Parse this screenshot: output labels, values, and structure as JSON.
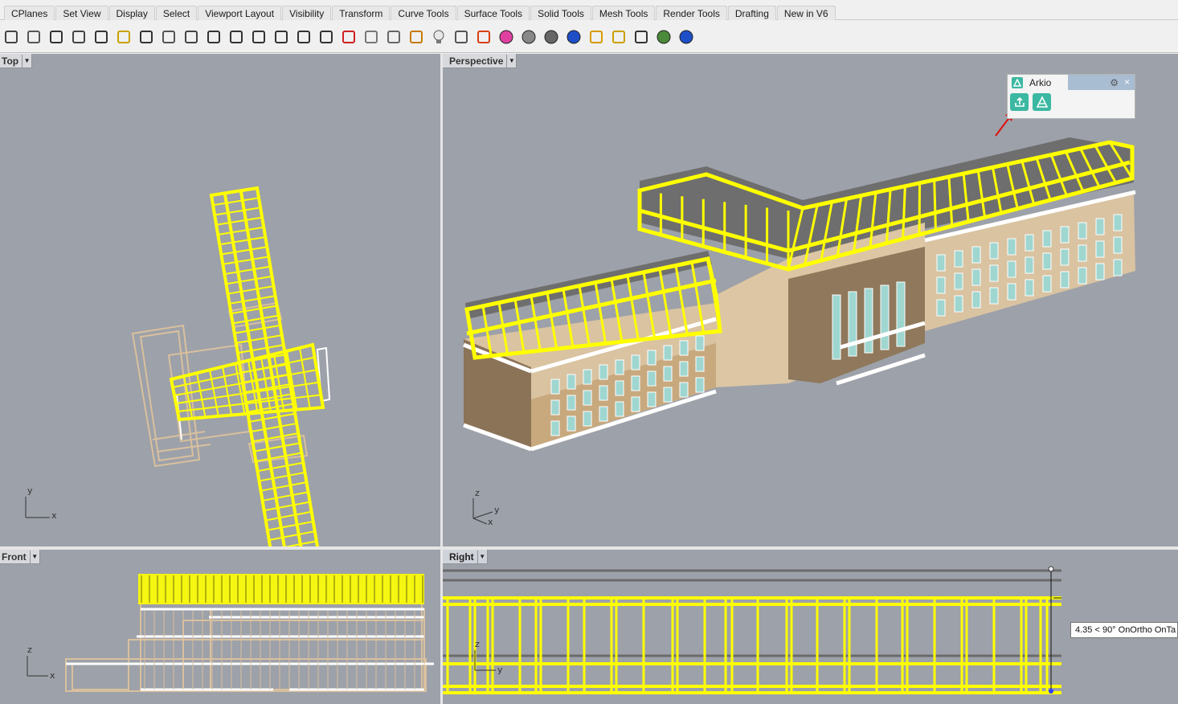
{
  "tabs": [
    "CPlanes",
    "Set View",
    "Display",
    "Select",
    "Viewport Layout",
    "Visibility",
    "Transform",
    "Curve Tools",
    "Surface Tools",
    "Solid Tools",
    "Mesh Tools",
    "Render Tools",
    "Drafting",
    "New in V6"
  ],
  "toolbar_icons": [
    "save-icon",
    "print-icon",
    "properties-icon",
    "cut-icon",
    "copy-icon",
    "paste-icon",
    "undo-icon",
    "pan-icon",
    "rotate-view-icon",
    "zoom-icon",
    "zoom-window-icon",
    "zoom-extents-icon",
    "zoom-selected-icon",
    "undo-view-icon",
    "four-viewports-icon",
    "car-icon",
    "ghosted-icon",
    "point-icon",
    "snap-icon",
    "light-bulb-icon",
    "lock-icon",
    "layer-icon",
    "color-wheel-icon",
    "shaded-sphere-icon",
    "rendered-sphere-icon",
    "blue-sphere-icon",
    "pencil-icon",
    "gear-settings-icon",
    "dimension-icon",
    "globe-icon",
    "help-icon"
  ],
  "viewports": {
    "top": {
      "label": "Top",
      "axis_x": "x",
      "axis_y": "y"
    },
    "perspective": {
      "label": "Perspective",
      "axis_z": "z",
      "axis_y": "y",
      "axis_x": "x"
    },
    "front": {
      "label": "Front",
      "axis_z": "z",
      "axis_x": "x"
    },
    "right": {
      "label": "Right",
      "axis_z": "z",
      "axis_y": "y"
    }
  },
  "arkio": {
    "title": "Arkio"
  },
  "tooltip": "4.35 < 90° OnOrtho OnTa",
  "colors": {
    "viewport_bg": "#9da1a9",
    "wire_yellow": "#ffff00",
    "arkio_teal": "#3bb8a2",
    "tan": "#d2b48c"
  }
}
